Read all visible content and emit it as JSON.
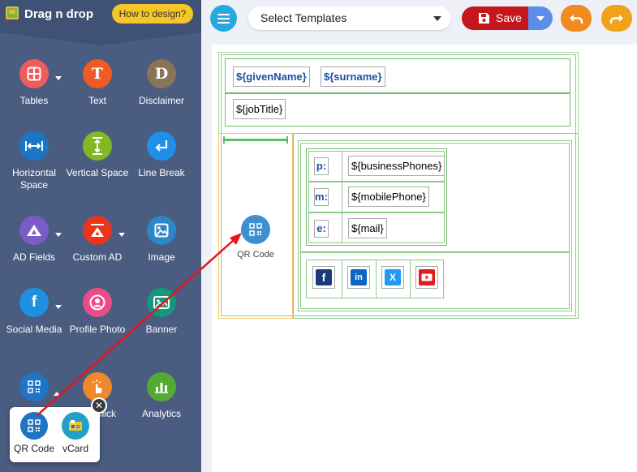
{
  "app": {
    "title": "Drag n drop",
    "how_to_label": "How to design?"
  },
  "tools": [
    {
      "label": "Tables",
      "icon": "table-icon",
      "color": "#f05b5b"
    },
    {
      "label": "Text",
      "icon": "text-icon",
      "glyph": "T",
      "color": "#ef5b24"
    },
    {
      "label": "Disclaimer",
      "icon": "disclaimer-icon",
      "glyph": "D",
      "color": "#8a7456"
    },
    {
      "label": "Horizontal Space",
      "icon": "horizontal-space-icon",
      "color": "#1a76c4"
    },
    {
      "label": "Vertical Space",
      "icon": "vertical-space-icon",
      "color": "#83b723"
    },
    {
      "label": "Line Break",
      "icon": "line-break-icon",
      "color": "#1f8fea"
    },
    {
      "label": "AD Fields",
      "icon": "ad-fields-icon",
      "color": "#7a5bc7"
    },
    {
      "label": "Custom AD",
      "icon": "custom-ad-icon",
      "color": "#e7361c"
    },
    {
      "label": "Image",
      "icon": "image-icon",
      "color": "#2d86c8"
    },
    {
      "label": "Social Media",
      "icon": "social-media-icon",
      "color": "#1f8fe0"
    },
    {
      "label": "Profile Photo",
      "icon": "profile-photo-icon",
      "color": "#ea4c89"
    },
    {
      "label": "Banner",
      "icon": "banner-icon",
      "color": "#14977a"
    },
    {
      "label": "",
      "icon": "qr-code-icon",
      "color": "#1f74c4"
    },
    {
      "label": "Click",
      "icon": "click-icon",
      "color": "#f0882a"
    },
    {
      "label": "Analytics",
      "icon": "analytics-icon",
      "color": "#55aa36"
    }
  ],
  "popup": {
    "items": [
      {
        "label": "QR Code",
        "icon": "qr-code-icon"
      },
      {
        "label": "vCard",
        "icon": "vcard-icon"
      }
    ],
    "close_glyph": "✕"
  },
  "toolbar": {
    "template_select": "Select Templates",
    "save_label": "Save"
  },
  "signature": {
    "given_name": "${givenName}",
    "surname": "${surname}",
    "job_title": "${jobTitle}",
    "qr_label": "QR Code",
    "contacts": [
      {
        "label": "p:",
        "value": "${businessPhones}"
      },
      {
        "label": "m:",
        "value": "${mobilePhone}"
      },
      {
        "label": "e:",
        "value": "${mail}"
      }
    ],
    "social": [
      "facebook-icon",
      "linkedin-icon",
      "x-icon",
      "youtube-icon"
    ]
  },
  "colors": {
    "sidebar": "#4a5d80",
    "accent": "#27a9e0",
    "save": "#c4161c",
    "arrow": "#e8141c"
  }
}
